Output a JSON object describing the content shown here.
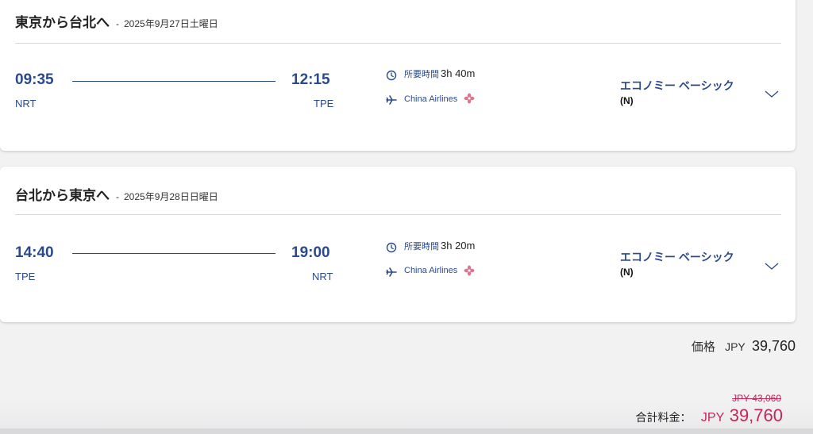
{
  "flights": [
    {
      "route": "東京から台北へ",
      "dash": "-",
      "date": "2025年9月27日土曜日",
      "depart_time": "09:35",
      "depart_code": "NRT",
      "arrive_time": "12:15",
      "arrive_code": "TPE",
      "duration_label": "所要時間",
      "duration": "3h 40m",
      "airline": "China Airlines",
      "fare_name": "エコノミー ベーシック",
      "fare_class": "(N)"
    },
    {
      "route": "台北から東京へ",
      "dash": "-",
      "date": "2025年9月28日日曜日",
      "depart_time": "14:40",
      "depart_code": "TPE",
      "arrive_time": "19:00",
      "arrive_code": "NRT",
      "duration_label": "所要時間",
      "duration": "3h 20m",
      "airline": "China Airlines",
      "fare_name": "エコノミー ベーシック",
      "fare_class": "(N)"
    }
  ],
  "price": {
    "label": "価格",
    "currency": "JPY",
    "amount": "39,760"
  },
  "total": {
    "old_price": "JPY 43,060",
    "label": "合計料金：",
    "currency": "JPY",
    "amount": "39,760"
  },
  "icons": {
    "clock": "clock-icon",
    "plane": "plane-icon",
    "airline_logo": "china-airlines-logo-icon",
    "expand": "chevron-down-icon"
  },
  "colors": {
    "primary": "#2b4a8b",
    "accent": "#c4255b",
    "logo": "#e0748e"
  }
}
